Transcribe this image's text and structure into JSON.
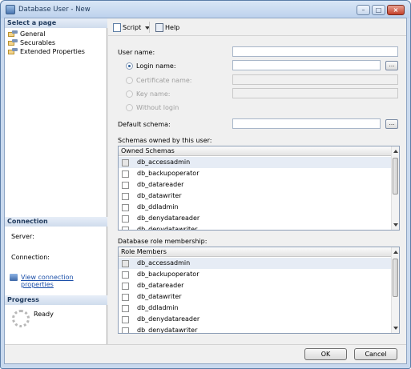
{
  "window": {
    "title": "Database User - New"
  },
  "left": {
    "select_page_header": "Select a page",
    "pages": [
      "General",
      "Securables",
      "Extended Properties"
    ],
    "connection_header": "Connection",
    "server_label": "Server:",
    "connection_label": "Connection:",
    "view_conn_link": "View connection properties",
    "progress_header": "Progress",
    "progress_status": "Ready"
  },
  "toolbar": {
    "script_label": "Script",
    "help_label": "Help"
  },
  "form": {
    "user_name_label": "User name:",
    "login_name_label": "Login name:",
    "certificate_name_label": "Certificate name:",
    "key_name_label": "Key name:",
    "without_login_label": "Without login",
    "default_schema_label": "Default schema:",
    "ellipsis": "...",
    "selected_radio": "Login name"
  },
  "schemas": {
    "label": "Schemas owned by this user:",
    "column": "Owned Schemas",
    "items": [
      "db_accessadmin",
      "db_backupoperator",
      "db_datareader",
      "db_datawriter",
      "db_ddladmin",
      "db_denydatareader",
      "db_denydatawriter"
    ]
  },
  "roles": {
    "label": "Database role membership:",
    "column": "Role Members",
    "items": [
      "db_accessadmin",
      "db_backupoperator",
      "db_datareader",
      "db_datawriter",
      "db_ddladmin",
      "db_denydatareader",
      "db_denydatawriter"
    ]
  },
  "buttons": {
    "ok": "OK",
    "cancel": "Cancel"
  }
}
